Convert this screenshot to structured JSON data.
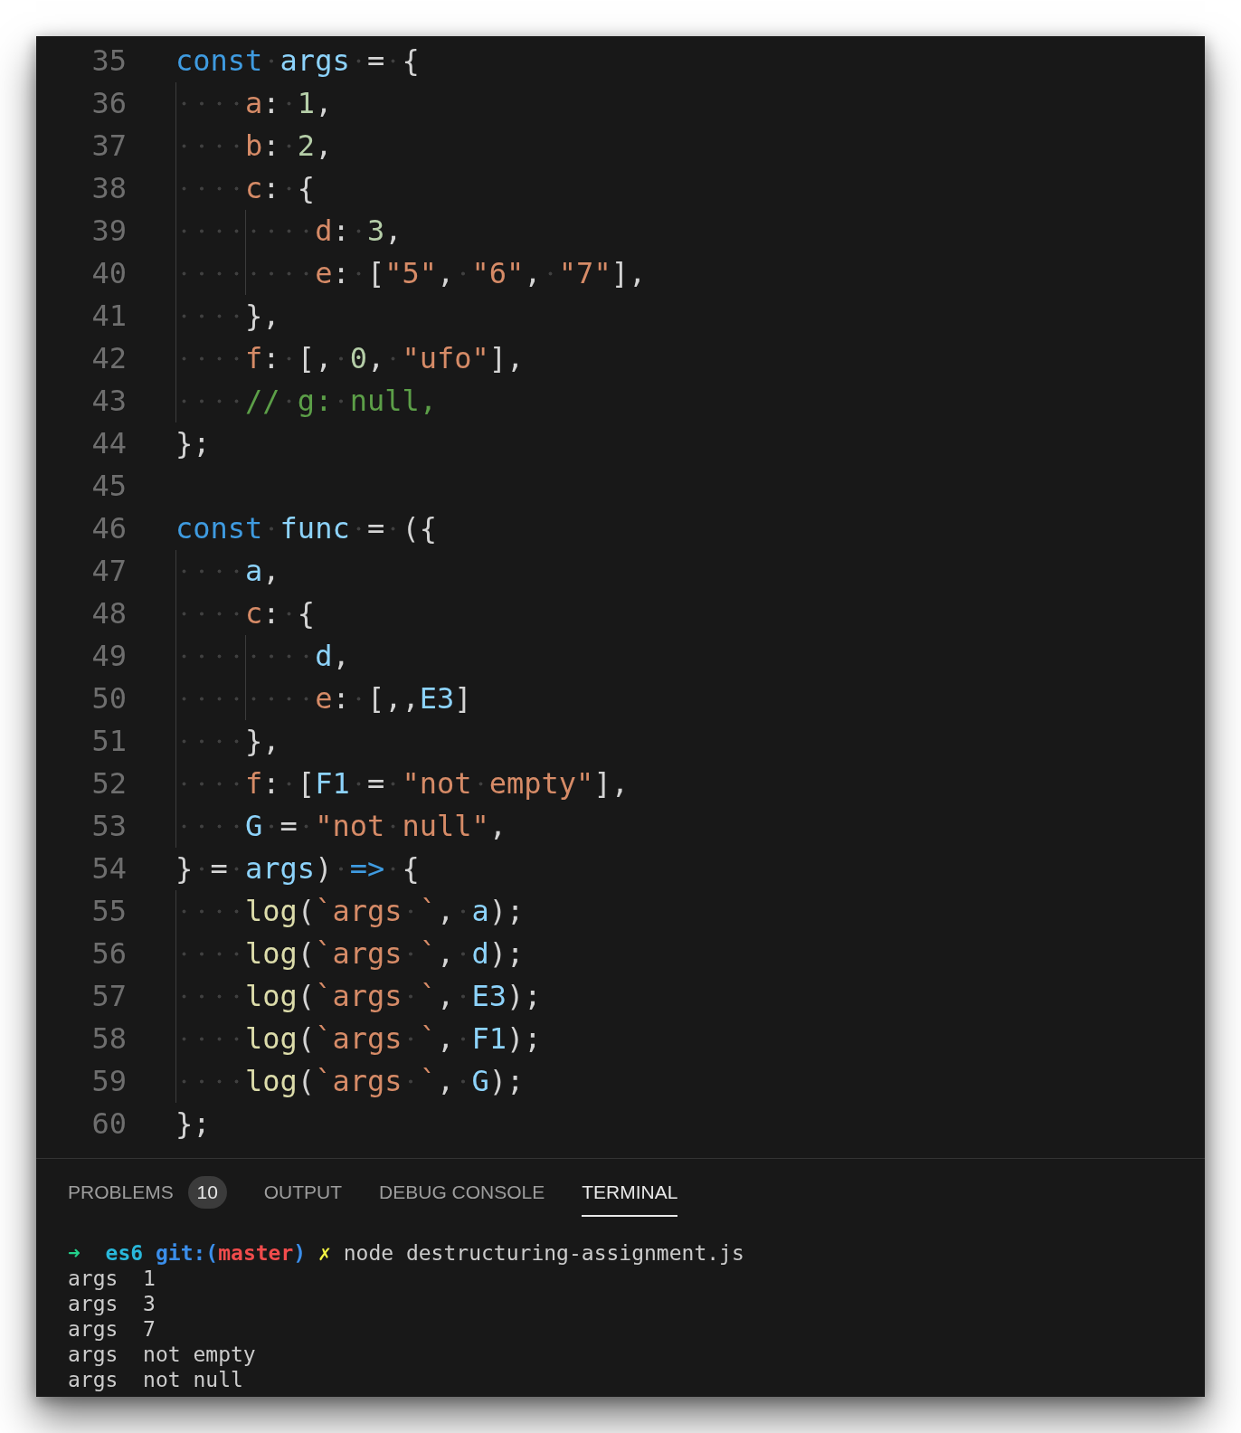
{
  "editor": {
    "lines": [
      {
        "number": "35",
        "tokens": [
          {
            "kind": "keyword",
            "text": "const "
          },
          {
            "kind": "variable",
            "text": "args"
          },
          {
            "kind": "punct",
            "text": " = {"
          }
        ]
      },
      {
        "number": "36",
        "tokens": [
          {
            "kind": "property",
            "text": "    a"
          },
          {
            "kind": "punct",
            "text": ": "
          },
          {
            "kind": "number",
            "text": "1"
          },
          {
            "kind": "punct",
            "text": ","
          }
        ]
      },
      {
        "number": "37",
        "tokens": [
          {
            "kind": "property",
            "text": "    b"
          },
          {
            "kind": "punct",
            "text": ": "
          },
          {
            "kind": "number",
            "text": "2"
          },
          {
            "kind": "punct",
            "text": ","
          }
        ]
      },
      {
        "number": "38",
        "tokens": [
          {
            "kind": "property",
            "text": "    c"
          },
          {
            "kind": "punct",
            "text": ": {"
          }
        ]
      },
      {
        "number": "39",
        "tokens": [
          {
            "kind": "property",
            "text": "        d"
          },
          {
            "kind": "punct",
            "text": ": "
          },
          {
            "kind": "number",
            "text": "3"
          },
          {
            "kind": "punct",
            "text": ","
          }
        ]
      },
      {
        "number": "40",
        "tokens": [
          {
            "kind": "property",
            "text": "        e"
          },
          {
            "kind": "punct",
            "text": ": ["
          },
          {
            "kind": "string",
            "text": "\"5\""
          },
          {
            "kind": "punct",
            "text": ", "
          },
          {
            "kind": "string",
            "text": "\"6\""
          },
          {
            "kind": "punct",
            "text": ", "
          },
          {
            "kind": "string",
            "text": "\"7\""
          },
          {
            "kind": "punct",
            "text": "],"
          }
        ]
      },
      {
        "number": "41",
        "tokens": [
          {
            "kind": "punct",
            "text": "    },"
          }
        ]
      },
      {
        "number": "42",
        "tokens": [
          {
            "kind": "property",
            "text": "    f"
          },
          {
            "kind": "punct",
            "text": ": [, "
          },
          {
            "kind": "number",
            "text": "0"
          },
          {
            "kind": "punct",
            "text": ", "
          },
          {
            "kind": "string",
            "text": "\"ufo\""
          },
          {
            "kind": "punct",
            "text": "],"
          }
        ]
      },
      {
        "number": "43",
        "tokens": [
          {
            "kind": "comment",
            "text": "    // g: null,"
          }
        ]
      },
      {
        "number": "44",
        "tokens": [
          {
            "kind": "punct",
            "text": "};"
          }
        ]
      },
      {
        "number": "45"
      },
      {
        "number": "46",
        "tokens": [
          {
            "kind": "keyword",
            "text": "const "
          },
          {
            "kind": "variable",
            "text": "func"
          },
          {
            "kind": "punct",
            "text": " = ({"
          }
        ]
      },
      {
        "number": "47",
        "tokens": [
          {
            "kind": "variable",
            "text": "    a"
          },
          {
            "kind": "punct",
            "text": ","
          }
        ]
      },
      {
        "number": "48",
        "tokens": [
          {
            "kind": "property",
            "text": "    c"
          },
          {
            "kind": "punct",
            "text": ": {"
          }
        ]
      },
      {
        "number": "49",
        "tokens": [
          {
            "kind": "variable",
            "text": "        d"
          },
          {
            "kind": "punct",
            "text": ","
          }
        ]
      },
      {
        "number": "50",
        "tokens": [
          {
            "kind": "property",
            "text": "        e"
          },
          {
            "kind": "punct",
            "text": ": [,,"
          },
          {
            "kind": "variable",
            "text": "E3"
          },
          {
            "kind": "punct",
            "text": "]"
          }
        ]
      },
      {
        "number": "51",
        "tokens": [
          {
            "kind": "punct",
            "text": "    },"
          }
        ]
      },
      {
        "number": "52",
        "tokens": [
          {
            "kind": "property",
            "text": "    f"
          },
          {
            "kind": "punct",
            "text": ": ["
          },
          {
            "kind": "variable",
            "text": "F1"
          },
          {
            "kind": "punct",
            "text": " = "
          },
          {
            "kind": "string",
            "text": "\"not empty\""
          },
          {
            "kind": "punct",
            "text": "],"
          }
        ]
      },
      {
        "number": "53",
        "tokens": [
          {
            "kind": "variable",
            "text": "    G"
          },
          {
            "kind": "punct",
            "text": " = "
          },
          {
            "kind": "string",
            "text": "\"not null\""
          },
          {
            "kind": "punct",
            "text": ","
          }
        ]
      },
      {
        "number": "54",
        "tokens": [
          {
            "kind": "punct",
            "text": "} = "
          },
          {
            "kind": "variable",
            "text": "args"
          },
          {
            "kind": "punct",
            "text": ") "
          },
          {
            "kind": "keyword",
            "text": "=>"
          },
          {
            "kind": "punct",
            "text": " {"
          }
        ]
      },
      {
        "number": "55",
        "tokens": [
          {
            "kind": "function",
            "text": "    log"
          },
          {
            "kind": "punct",
            "text": "("
          },
          {
            "kind": "string",
            "text": "`args `"
          },
          {
            "kind": "punct",
            "text": ", "
          },
          {
            "kind": "variable",
            "text": "a"
          },
          {
            "kind": "punct",
            "text": ");"
          }
        ]
      },
      {
        "number": "56",
        "tokens": [
          {
            "kind": "function",
            "text": "    log"
          },
          {
            "kind": "punct",
            "text": "("
          },
          {
            "kind": "string",
            "text": "`args `"
          },
          {
            "kind": "punct",
            "text": ", "
          },
          {
            "kind": "variable",
            "text": "d"
          },
          {
            "kind": "punct",
            "text": ");"
          }
        ]
      },
      {
        "number": "57",
        "tokens": [
          {
            "kind": "function",
            "text": "    log"
          },
          {
            "kind": "punct",
            "text": "("
          },
          {
            "kind": "string",
            "text": "`args `"
          },
          {
            "kind": "punct",
            "text": ", "
          },
          {
            "kind": "variable",
            "text": "E3"
          },
          {
            "kind": "punct",
            "text": ");"
          }
        ]
      },
      {
        "number": "58",
        "tokens": [
          {
            "kind": "function",
            "text": "    log"
          },
          {
            "kind": "punct",
            "text": "("
          },
          {
            "kind": "string",
            "text": "`args `"
          },
          {
            "kind": "punct",
            "text": ", "
          },
          {
            "kind": "variable",
            "text": "F1"
          },
          {
            "kind": "punct",
            "text": ");"
          }
        ]
      },
      {
        "number": "59",
        "tokens": [
          {
            "kind": "function",
            "text": "    log"
          },
          {
            "kind": "punct",
            "text": "("
          },
          {
            "kind": "string",
            "text": "`args `"
          },
          {
            "kind": "punct",
            "text": ", "
          },
          {
            "kind": "variable",
            "text": "G"
          },
          {
            "kind": "punct",
            "text": ");"
          }
        ]
      },
      {
        "number": "60",
        "tokens": [
          {
            "kind": "punct",
            "text": "};"
          }
        ]
      }
    ]
  },
  "panel": {
    "tabs": [
      {
        "label": "PROBLEMS",
        "selected": false,
        "badge": "10"
      },
      {
        "label": "OUTPUT",
        "selected": false
      },
      {
        "label": "DEBUG CONSOLE",
        "selected": false
      },
      {
        "label": "TERMINAL",
        "selected": true
      }
    ]
  },
  "terminal": {
    "lines": [
      {
        "kind": "prompt",
        "segments": [
          {
            "kind": "arrow",
            "text": "➜  "
          },
          {
            "kind": "dir",
            "text": "es6 "
          },
          {
            "kind": "git",
            "text": "git:("
          },
          {
            "kind": "branch",
            "text": "master"
          },
          {
            "kind": "git",
            "text": ") "
          },
          {
            "kind": "dirty",
            "text": "✗ "
          },
          {
            "kind": "command",
            "text": "node destructuring-assignment.js"
          }
        ]
      },
      {
        "kind": "output",
        "text": "args  1"
      },
      {
        "kind": "output",
        "text": "args  3"
      },
      {
        "kind": "output",
        "text": "args  7"
      },
      {
        "kind": "output",
        "text": "args  not empty"
      },
      {
        "kind": "output",
        "text": "args  not null"
      }
    ]
  }
}
